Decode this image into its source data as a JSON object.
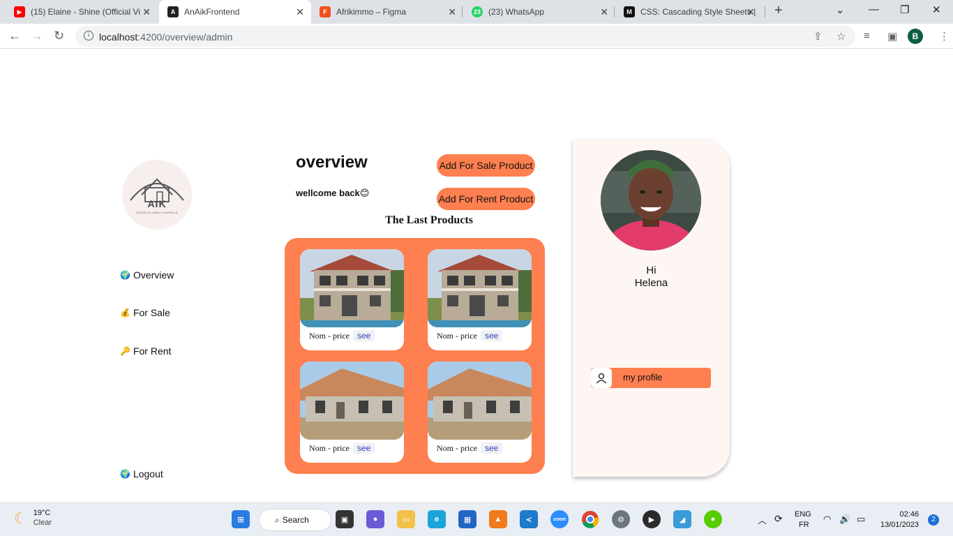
{
  "browser": {
    "tabs": [
      {
        "title": "(15) Elaine - Shine (Official Vi",
        "favicon": "youtube-icon"
      },
      {
        "title": "AnAikFrontend",
        "favicon": "angular-icon"
      },
      {
        "title": "Afrikimmo – Figma",
        "favicon": "figma-icon"
      },
      {
        "title": "(23) WhatsApp",
        "favicon": "whatsapp-icon"
      },
      {
        "title": "CSS: Cascading Style Sheets |",
        "favicon": "mdn-icon"
      }
    ],
    "url_host": "localhost",
    "url_path": ":4200/overview/admin",
    "profile_initial": "B"
  },
  "sidebar": {
    "logo_text": "AIK",
    "logo_sub": "AGENCIA IMMO KAMPALA",
    "items": [
      {
        "label": "Overview",
        "icon": "globe-icon"
      },
      {
        "label": "For Sale",
        "icon": "money-bag-icon"
      },
      {
        "label": "For Rent",
        "icon": "key-icon"
      }
    ],
    "logout": "Logout"
  },
  "main": {
    "title": "overview",
    "welcome": "wellcome back😊",
    "add_sale": "Add For Sale Product",
    "add_rent": "Add For Rent Product",
    "last_products_title": "The Last Products",
    "products": [
      {
        "caption": "Nom - price",
        "action": "see",
        "kind": "two-storey-villa"
      },
      {
        "caption": "Nom - price",
        "action": "see",
        "kind": "two-storey-villa"
      },
      {
        "caption": "Nom - price",
        "action": "see",
        "kind": "bungalow"
      },
      {
        "caption": "Nom - price",
        "action": "see",
        "kind": "bungalow"
      }
    ]
  },
  "profile": {
    "greeting": "Hi",
    "name": "Helena",
    "button": "my profile"
  },
  "taskbar": {
    "temp": "19°C",
    "condition": "Clear",
    "search": "Search",
    "lang1": "ENG",
    "lang2": "FR",
    "time": "02:46",
    "date": "13/01/2023",
    "notifications": "2"
  },
  "colors": {
    "accent": "#fe7f50",
    "panel": "#fdf6f2"
  }
}
